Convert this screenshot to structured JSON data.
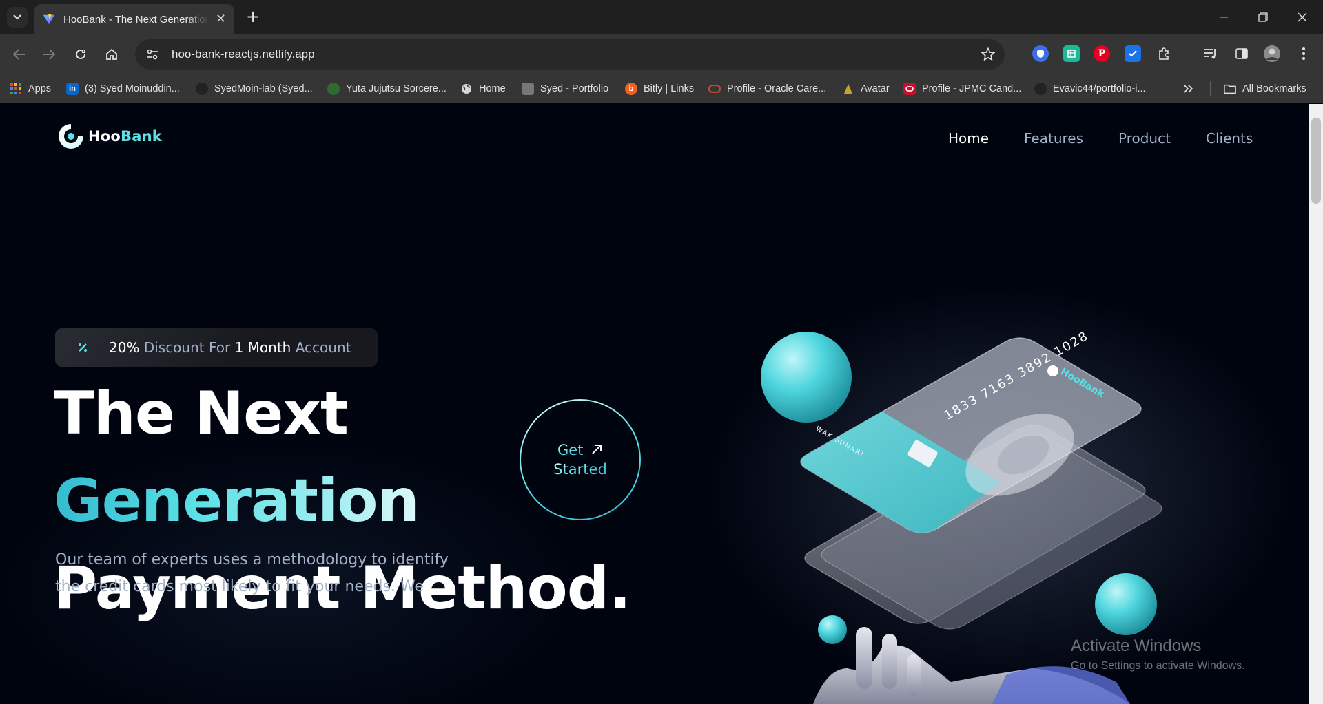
{
  "browser": {
    "tab_title": "HooBank - The Next Generation Payment Method",
    "url": "hoo-bank-reactjs.netlify.app",
    "bookmarks": [
      {
        "label": "Apps",
        "icon": "apps-grid-icon"
      },
      {
        "label": "(3) Syed Moinuddin...",
        "icon": "linkedin-icon"
      },
      {
        "label": "SyedMoin-lab (Syed...",
        "icon": "github-icon"
      },
      {
        "label": "Yuta Jujutsu Sorcere...",
        "icon": "character-icon"
      },
      {
        "label": "Home",
        "icon": "globe-icon"
      },
      {
        "label": "Syed - Portfolio",
        "icon": "portfolio-icon"
      },
      {
        "label": "Bitly | Links",
        "icon": "bitly-icon"
      },
      {
        "label": "Profile - Oracle Care...",
        "icon": "oracle-icon"
      },
      {
        "label": "Avatar",
        "icon": "avatar-icon"
      },
      {
        "label": "Profile - JPMC Cand...",
        "icon": "jpmc-icon"
      },
      {
        "label": "Evavic44/portfolio-i...",
        "icon": "github-icon"
      }
    ],
    "all_bookmarks_label": "All Bookmarks"
  },
  "site": {
    "logo": {
      "part1": "Hoo",
      "part2": "Bank"
    },
    "nav": [
      {
        "label": "Home",
        "active": true
      },
      {
        "label": "Features",
        "active": false
      },
      {
        "label": "Product",
        "active": false
      },
      {
        "label": "Clients",
        "active": false
      }
    ],
    "discount": {
      "percent": "20%",
      "t1": " Discount For ",
      "month": "1 Month",
      "t2": " Account"
    },
    "heading": {
      "line1": "The Next",
      "line2": "Generation",
      "line3": "Payment Method."
    },
    "subtext": "Our team of experts uses a methodology to identify the credit cards most likely to fit your needs. We",
    "cta": {
      "line1": "Get",
      "line2": "Started"
    },
    "card": {
      "number": "1833 7163 3892 1028",
      "holder": "WAK SUNARI",
      "brand": "HooBank"
    }
  },
  "os_watermark": {
    "title": "Activate Windows",
    "subtitle": "Go to Settings to activate Windows."
  },
  "colors": {
    "background": "#00040f",
    "accent": "#5ce1e6",
    "dim_text": "#a3b1c6"
  }
}
